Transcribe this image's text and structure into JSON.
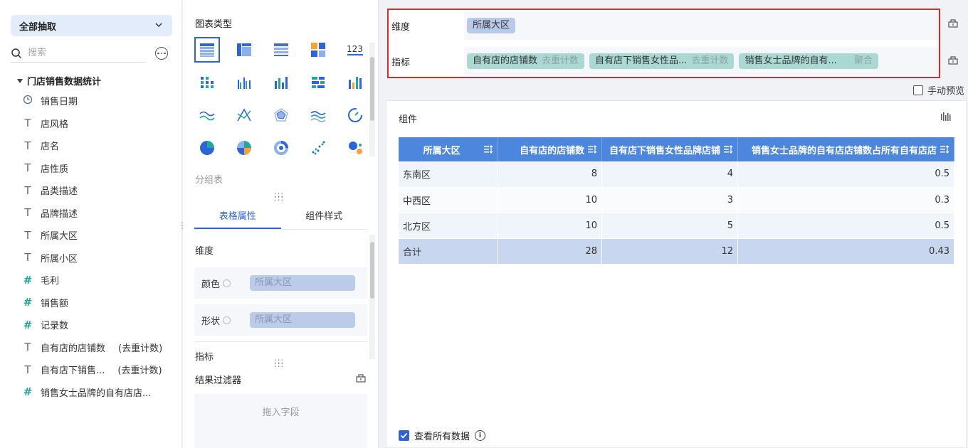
{
  "left_panel": {
    "extract_label": "全部抽取",
    "search_placeholder": "搜索",
    "table_name": "门店销售数据统计",
    "fields": [
      {
        "type": "date",
        "name": "销售日期",
        "agg": ""
      },
      {
        "type": "text",
        "name": "店风格",
        "agg": ""
      },
      {
        "type": "text",
        "name": "店名",
        "agg": ""
      },
      {
        "type": "text",
        "name": "店性质",
        "agg": ""
      },
      {
        "type": "text",
        "name": "品类描述",
        "agg": ""
      },
      {
        "type": "text",
        "name": "品牌描述",
        "agg": ""
      },
      {
        "type": "text",
        "name": "所属大区",
        "agg": ""
      },
      {
        "type": "text",
        "name": "所属小区",
        "agg": ""
      },
      {
        "type": "number",
        "name": "毛利",
        "agg": ""
      },
      {
        "type": "number",
        "name": "销售额",
        "agg": ""
      },
      {
        "type": "number-calc",
        "name": "记录数",
        "agg": ""
      },
      {
        "type": "text",
        "name": "自有店的店铺数",
        "agg": "(去重计数)"
      },
      {
        "type": "text",
        "name": "自有店下销售...",
        "agg": "(去重计数)"
      },
      {
        "type": "number-calc",
        "name": "销售女士品牌的自有店店...",
        "agg": ""
      }
    ]
  },
  "middle_panel": {
    "chart_type_title": "图表类型",
    "chart_types": [
      "table-icon",
      "cross-table-icon",
      "detail-table-icon",
      "kpi-card-icon",
      "number-icon",
      "dot-matrix-icon",
      "grouped-bar-icon",
      "bar-chart-icon",
      "stacked-bar-icon",
      "colored-bar-icon",
      "wave-line-icon",
      "radar-line-icon",
      "radar-icon",
      "area-wave-icon",
      "gauge-icon",
      "pie-icon",
      "rose-pie-icon",
      "donut-icon",
      "scatter-icon",
      "bubble-icon"
    ],
    "group_label": "分组表",
    "tabs": [
      "表格属性",
      "组件样式"
    ],
    "dimension_label": "维度",
    "color_label": "颜色",
    "color_field": "所属大区",
    "shape_label": "形状",
    "shape_field": "所属大区",
    "metric_label": "指标",
    "filter_title": "结果过滤器",
    "drop_hint": "拖入字段"
  },
  "config": {
    "dimension_label": "维度",
    "dimension_chips": [
      "所属大区"
    ],
    "metric_label": "指标",
    "metric_chips": [
      {
        "name": "自有店的店铺数",
        "tag": "去重计数"
      },
      {
        "name": "自有店下销售女性品...",
        "tag": "去重计数"
      },
      {
        "name": "销售女士品牌的自有...",
        "tag": "聚合"
      }
    ],
    "manual_preview": "手动预览"
  },
  "widget": {
    "title": "组件",
    "columns": [
      "所属大区",
      "自有店的店铺数",
      "自有店下销售女性品牌店铺",
      "销售女士品牌的自有店店铺数占所有自有店店"
    ],
    "rows": [
      [
        "东南区",
        "8",
        "4",
        "0.5"
      ],
      [
        "中西区",
        "10",
        "3",
        "0.3"
      ],
      [
        "北方区",
        "10",
        "5",
        "0.5"
      ]
    ],
    "total": [
      "合计",
      "28",
      "12",
      "0.43"
    ],
    "view_all_label": "查看所有数据"
  },
  "colors": {
    "accent": "#2f64d6",
    "header_bg": "#4d86dd",
    "dim_chip": "#b8c9ea",
    "metric_chip": "#aad9d4",
    "highlight_border": "#e3262e"
  }
}
